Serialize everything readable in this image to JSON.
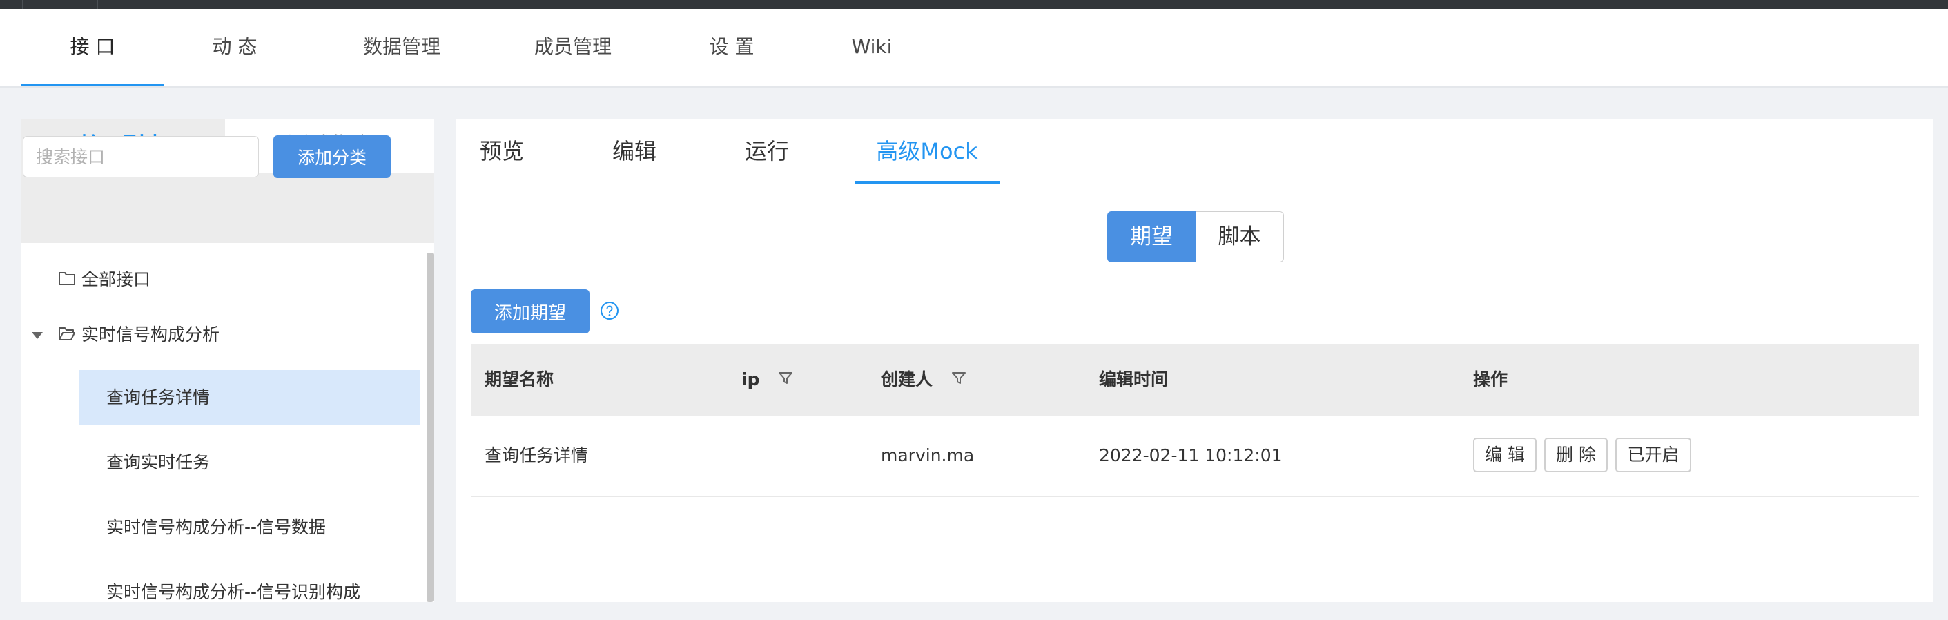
{
  "project_nav": {
    "tabs": [
      {
        "label": "接 口",
        "active": true
      },
      {
        "label": "动 态"
      },
      {
        "label": "数据管理"
      },
      {
        "label": "成员管理"
      },
      {
        "label": "设 置"
      },
      {
        "label": "Wiki"
      }
    ]
  },
  "sidebar": {
    "tabs": [
      {
        "label": "接口列表",
        "active": true
      },
      {
        "label": "测试集合"
      }
    ],
    "search": {
      "placeholder": "搜索接口",
      "value": ""
    },
    "add_category_label": "添加分类",
    "tree": {
      "all_label": "全部接口",
      "category": {
        "label": "实时信号构成分析",
        "expanded": true
      },
      "items": [
        {
          "label": "查询任务详情",
          "selected": true
        },
        {
          "label": "查询实时任务"
        },
        {
          "label": "实时信号构成分析--信号数据"
        },
        {
          "label": "实时信号构成分析--信号识别构成"
        }
      ]
    }
  },
  "main": {
    "tabs": [
      {
        "label": "预览"
      },
      {
        "label": "编辑"
      },
      {
        "label": "运行"
      },
      {
        "label": "高级Mock",
        "active": true
      }
    ],
    "mode_toggle": [
      {
        "label": "期望",
        "active": true
      },
      {
        "label": "脚本"
      }
    ],
    "add_expectation_label": "添加期望",
    "table": {
      "columns": [
        "期望名称",
        "ip",
        "创建人",
        "编辑时间",
        "操作"
      ],
      "rows": [
        {
          "name": "查询任务详情",
          "ip": "",
          "creator": "marvin.ma",
          "edit_time": "2022-02-11 10:12:01",
          "actions": [
            "编 辑",
            "删 除",
            "已开启"
          ]
        }
      ]
    }
  },
  "colors": {
    "accent": "#2395f1",
    "button_primary": "#4a90e2",
    "selected_row": "#d8e8fb",
    "topbar": "#32363a"
  }
}
